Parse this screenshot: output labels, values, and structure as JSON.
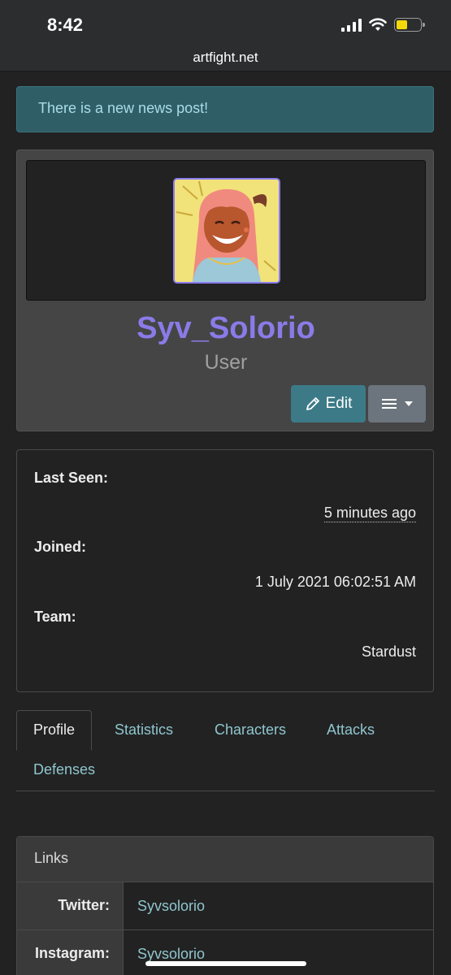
{
  "status": {
    "time": "8:42"
  },
  "browser": {
    "url": "artfight.net"
  },
  "alert": {
    "text": "There is a new news post!"
  },
  "profile": {
    "username": "Syv_Solorio",
    "role": "User",
    "edit_label": "Edit"
  },
  "info": {
    "last_seen_label": "Last Seen:",
    "last_seen_value": "5 minutes ago",
    "joined_label": "Joined:",
    "joined_value": "1 July 2021 06:02:51 AM",
    "team_label": "Team:",
    "team_value": "Stardust"
  },
  "tabs": [
    {
      "label": "Profile",
      "active": true
    },
    {
      "label": "Statistics"
    },
    {
      "label": "Characters"
    },
    {
      "label": "Attacks"
    },
    {
      "label": "Defenses"
    }
  ],
  "links": {
    "title": "Links",
    "rows": [
      {
        "label": "Twitter:",
        "value": "Syvsolorio"
      },
      {
        "label": "Instagram:",
        "value": "Syvsolorio"
      }
    ]
  },
  "colors": {
    "accent": "#8a7be8",
    "link": "#8fc6cf",
    "edit_button": "#3d7a87",
    "alert_bg": "#2f5e66"
  },
  "icons": [
    "signal-icon",
    "wifi-icon",
    "battery-icon",
    "pencil-icon",
    "hamburger-icon",
    "caret-down-icon"
  ]
}
